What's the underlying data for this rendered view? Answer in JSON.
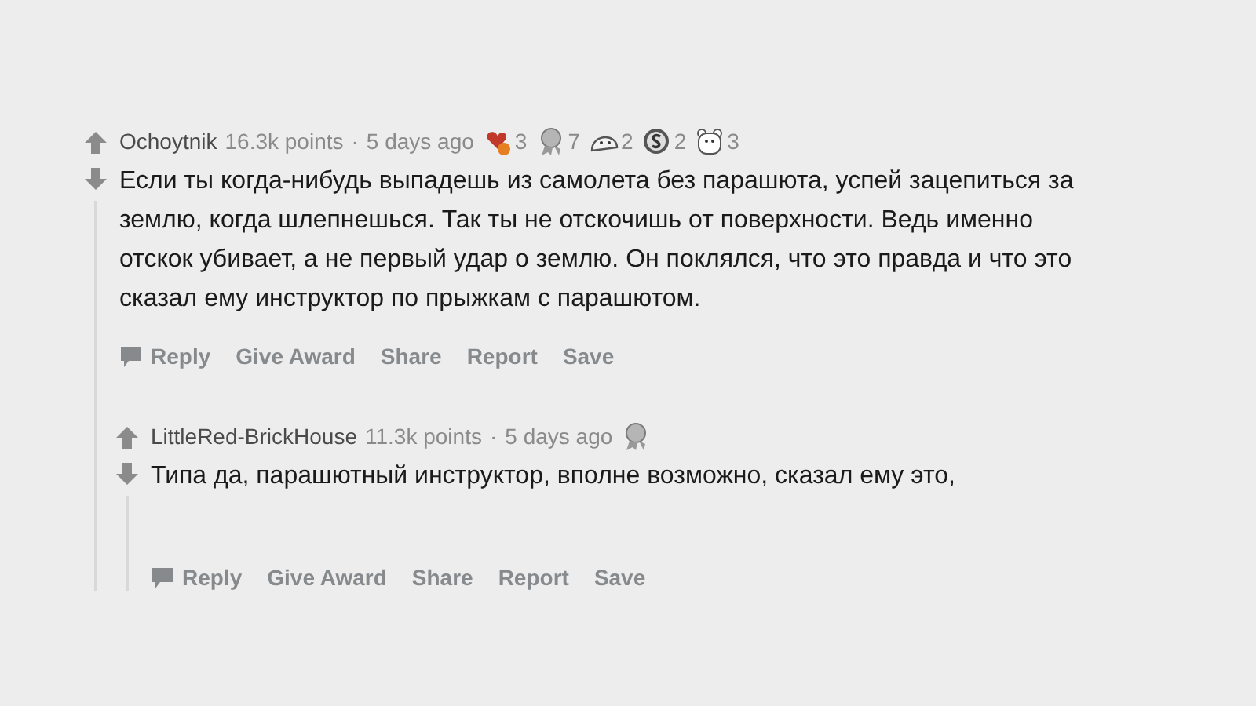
{
  "comments": [
    {
      "author": "Ochoytnik",
      "points": "16.3k points",
      "separator": "·",
      "time": "5 days ago",
      "awards": [
        {
          "kind": "hands",
          "count": "3"
        },
        {
          "kind": "silver",
          "count": "7"
        },
        {
          "kind": "face",
          "count": "2"
        },
        {
          "kind": "coin",
          "count": "2"
        },
        {
          "kind": "bear",
          "count": "3"
        }
      ],
      "body": "Если ты когда-нибудь выпадешь из самолета без парашюта, успей зацепиться за землю, когда шлепнешься. Так ты не отскочишь от поверхности. Ведь именно отскок убивает, а не первый удар о землю. Он поклялся, что это правда и что это сказал ему инструктор по прыжкам с парашютом.",
      "actions": [
        "Reply",
        "Give Award",
        "Share",
        "Report",
        "Save"
      ],
      "replies": [
        {
          "author": "LittleRed-BrickHouse",
          "points": "11.3k points",
          "separator": "·",
          "time": "5 days ago",
          "awards": [
            {
              "kind": "silver"
            }
          ],
          "body": "Типа да, парашютный инструктор, вполне возможно, сказал ему это,",
          "actions": [
            "Reply",
            "Give Award",
            "Share",
            "Report",
            "Save"
          ]
        }
      ]
    }
  ]
}
